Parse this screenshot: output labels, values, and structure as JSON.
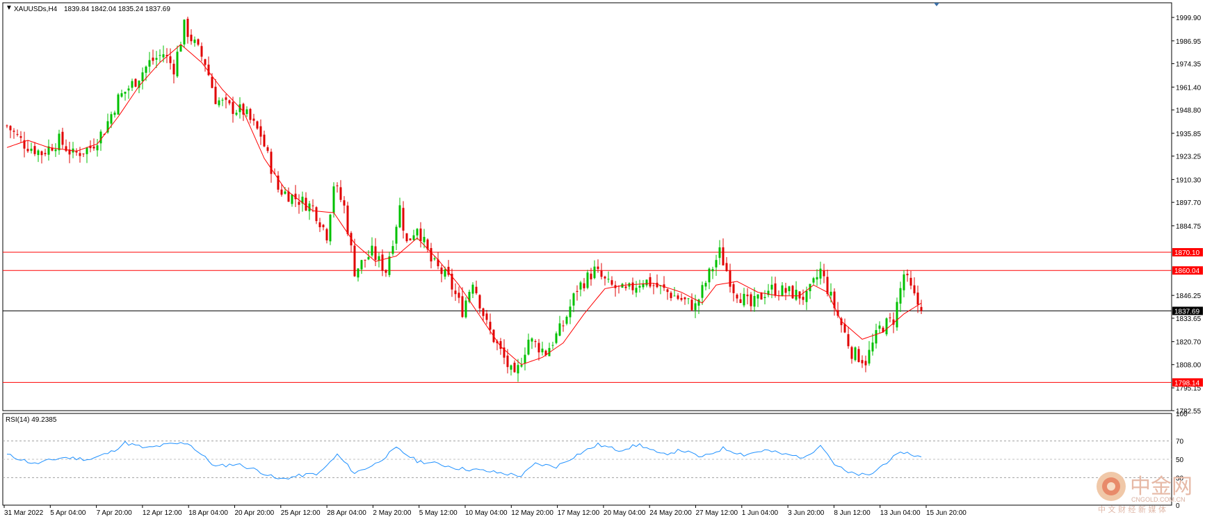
{
  "chart_data": {
    "type": "candlestick",
    "symbol_header": "XAUUSDs,H4",
    "ohlc_readout": "1839.84 1842.04 1835.24 1837.69",
    "ylim": [
      1782.55,
      2008
    ],
    "price_ticks": [
      "1999.90",
      "1986.95",
      "1974.35",
      "1961.40",
      "1948.80",
      "1935.85",
      "1923.25",
      "1910.30",
      "1897.70",
      "1884.75",
      "1846.25",
      "1833.65",
      "1820.70",
      "1808.00",
      "1795.15",
      "1782.55"
    ],
    "levels": [
      {
        "value": 1870.1,
        "label": "1870.10",
        "color": "#ff0000"
      },
      {
        "value": 1860.04,
        "label": "1860.04",
        "color": "#ff0000"
      },
      {
        "value": 1837.69,
        "label": "1837.69",
        "color": "#000000"
      },
      {
        "value": 1798.14,
        "label": "1798.14",
        "color": "#ff0000"
      }
    ],
    "x_labels": [
      "31 Mar 2022",
      "5 Apr 04:00",
      "7 Apr 20:00",
      "12 Apr 12:00",
      "18 Apr 04:00",
      "20 Apr 20:00",
      "25 Apr 12:00",
      "28 Apr 04:00",
      "2 May 20:00",
      "5 May 12:00",
      "10 May 04:00",
      "12 May 20:00",
      "17 May 12:00",
      "20 May 04:00",
      "24 May 20:00",
      "27 May 12:00",
      "1 Jun 04:00",
      "3 Jun 20:00",
      "8 Jun 12:00",
      "13 Jun 04:00",
      "15 Jun 20:00"
    ],
    "close_path": [
      [
        0,
        1940
      ],
      [
        5,
        1930
      ],
      [
        10,
        1925
      ],
      [
        15,
        1932
      ],
      [
        19,
        1924
      ],
      [
        24,
        1928
      ],
      [
        28,
        1938
      ],
      [
        32,
        1955
      ],
      [
        37,
        1965
      ],
      [
        41,
        1975
      ],
      [
        45,
        1980
      ],
      [
        48,
        1972
      ],
      [
        51,
        1995
      ],
      [
        54,
        1985
      ],
      [
        57,
        1975
      ],
      [
        60,
        1955
      ],
      [
        64,
        1950
      ],
      [
        68,
        1948
      ],
      [
        73,
        1935
      ],
      [
        78,
        1905
      ],
      [
        83,
        1900
      ],
      [
        88,
        1895
      ],
      [
        92,
        1880
      ],
      [
        94,
        1908
      ],
      [
        97,
        1895
      ],
      [
        100,
        1860
      ],
      [
        105,
        1870
      ],
      [
        109,
        1860
      ],
      [
        113,
        1895
      ],
      [
        115,
        1875
      ],
      [
        118,
        1885
      ],
      [
        122,
        1865
      ],
      [
        127,
        1855
      ],
      [
        131,
        1838
      ],
      [
        134,
        1855
      ],
      [
        138,
        1830
      ],
      [
        142,
        1815
      ],
      [
        146,
        1800
      ],
      [
        150,
        1822
      ],
      [
        155,
        1815
      ],
      [
        160,
        1830
      ],
      [
        164,
        1850
      ],
      [
        169,
        1860
      ],
      [
        173,
        1852
      ],
      [
        178,
        1848
      ],
      [
        183,
        1855
      ],
      [
        188,
        1850
      ],
      [
        193,
        1845
      ],
      [
        198,
        1840
      ],
      [
        202,
        1858
      ],
      [
        205,
        1870
      ],
      [
        209,
        1850
      ],
      [
        214,
        1840
      ],
      [
        219,
        1850
      ],
      [
        225,
        1848
      ],
      [
        230,
        1845
      ],
      [
        234,
        1860
      ],
      [
        238,
        1840
      ],
      [
        243,
        1815
      ],
      [
        247,
        1810
      ],
      [
        251,
        1828
      ],
      [
        255,
        1833
      ],
      [
        258,
        1858
      ],
      [
        261,
        1845
      ],
      [
        263,
        1838
      ]
    ],
    "ma_path": [
      [
        0,
        1928
      ],
      [
        6,
        1932
      ],
      [
        12,
        1928
      ],
      [
        20,
        1926
      ],
      [
        26,
        1930
      ],
      [
        32,
        1945
      ],
      [
        38,
        1962
      ],
      [
        44,
        1975
      ],
      [
        50,
        1985
      ],
      [
        56,
        1975
      ],
      [
        62,
        1960
      ],
      [
        68,
        1948
      ],
      [
        74,
        1922
      ],
      [
        80,
        1905
      ],
      [
        88,
        1893
      ],
      [
        94,
        1892
      ],
      [
        100,
        1875
      ],
      [
        106,
        1865
      ],
      [
        112,
        1868
      ],
      [
        118,
        1878
      ],
      [
        124,
        1866
      ],
      [
        130,
        1852
      ],
      [
        136,
        1835
      ],
      [
        142,
        1818
      ],
      [
        148,
        1808
      ],
      [
        154,
        1812
      ],
      [
        160,
        1820
      ],
      [
        166,
        1836
      ],
      [
        172,
        1850
      ],
      [
        178,
        1852
      ],
      [
        186,
        1853
      ],
      [
        194,
        1848
      ],
      [
        200,
        1842
      ],
      [
        204,
        1852
      ],
      [
        210,
        1854
      ],
      [
        216,
        1848
      ],
      [
        222,
        1846
      ],
      [
        228,
        1846
      ],
      [
        232,
        1852
      ],
      [
        236,
        1848
      ],
      [
        240,
        1832
      ],
      [
        246,
        1822
      ],
      [
        252,
        1826
      ],
      [
        258,
        1836
      ],
      [
        263,
        1842
      ]
    ],
    "rsi": {
      "label": "RSI(14) 49.2385",
      "ylim": [
        0,
        100
      ],
      "ticks": [
        "100",
        "70",
        "50",
        "30",
        "0"
      ],
      "levels": [
        70,
        30
      ],
      "path": [
        [
          0,
          55
        ],
        [
          8,
          45
        ],
        [
          16,
          52
        ],
        [
          24,
          50
        ],
        [
          30,
          58
        ],
        [
          34,
          68
        ],
        [
          40,
          62
        ],
        [
          46,
          66
        ],
        [
          52,
          68
        ],
        [
          56,
          55
        ],
        [
          60,
          42
        ],
        [
          66,
          45
        ],
        [
          72,
          38
        ],
        [
          78,
          28
        ],
        [
          84,
          32
        ],
        [
          90,
          35
        ],
        [
          95,
          55
        ],
        [
          100,
          35
        ],
        [
          106,
          45
        ],
        [
          112,
          62
        ],
        [
          118,
          48
        ],
        [
          124,
          45
        ],
        [
          130,
          40
        ],
        [
          136,
          38
        ],
        [
          142,
          35
        ],
        [
          148,
          32
        ],
        [
          152,
          45
        ],
        [
          158,
          42
        ],
        [
          164,
          55
        ],
        [
          170,
          66
        ],
        [
          176,
          60
        ],
        [
          182,
          66
        ],
        [
          188,
          55
        ],
        [
          194,
          60
        ],
        [
          200,
          52
        ],
        [
          206,
          62
        ],
        [
          212,
          55
        ],
        [
          218,
          60
        ],
        [
          224,
          55
        ],
        [
          230,
          52
        ],
        [
          234,
          67
        ],
        [
          238,
          45
        ],
        [
          242,
          35
        ],
        [
          248,
          32
        ],
        [
          254,
          50
        ],
        [
          258,
          58
        ],
        [
          263,
          52
        ]
      ]
    }
  },
  "watermark": {
    "title": "中金网",
    "domain": "CNGOLD.COM.CN",
    "tagline": "中 文 财 经 新 媒 体"
  }
}
